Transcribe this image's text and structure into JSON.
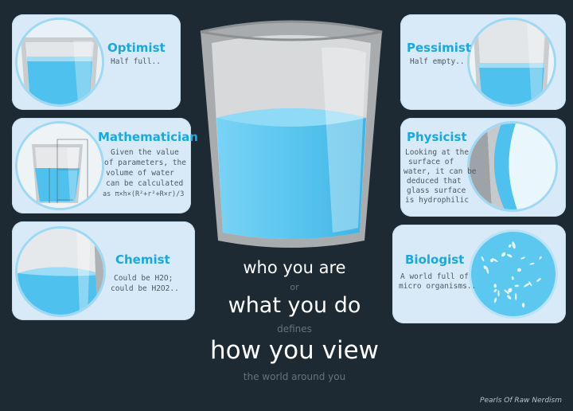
{
  "cards": {
    "optimist": {
      "title": "Optimist",
      "lines": [
        "Half full.."
      ]
    },
    "pessimist": {
      "title": "Pessimist",
      "lines": [
        "Half empty.."
      ]
    },
    "mathematician": {
      "title": "Mathematician",
      "lines": [
        "Given the value",
        "of parameters, the",
        "volume of water",
        "can be calculated",
        "as π×h×(R²+r²+R×r)/3"
      ]
    },
    "physicist": {
      "title": "Physicist",
      "lines": [
        "Looking at the",
        "surface of",
        "water, it can be",
        "deduced that",
        "glass surface",
        "is hydrophilic"
      ]
    },
    "chemist": {
      "title": "Chemist",
      "lines": [
        "Could be H2O;",
        "could be H2O2.."
      ]
    },
    "biologist": {
      "title": "Biologist",
      "lines": [
        "A world full of",
        "micro organisms.."
      ]
    }
  },
  "center": {
    "line1": "who you are",
    "line2": "or",
    "line3": "what you do",
    "line4": "defines",
    "line5": "how you view",
    "line6": "the world around you"
  },
  "credit": "Pearls Of Raw Nerdism",
  "colors": {
    "background": "#1d2a33",
    "card": "#d8eaf7",
    "accent": "#1aa8e0",
    "water": "#5cc8f0",
    "glass": "#9ea3a7"
  }
}
